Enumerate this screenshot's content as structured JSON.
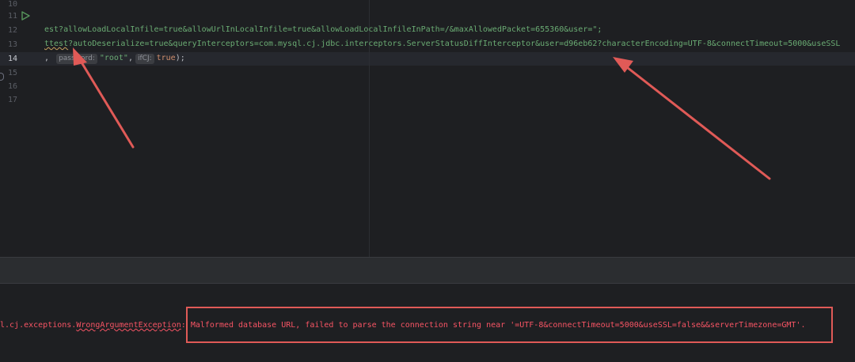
{
  "gutter": {
    "line_numbers": [
      "10",
      "11",
      "12",
      "13",
      "14",
      "15",
      "16",
      "17"
    ],
    "current_line": "14"
  },
  "code": {
    "line12": "est?allowLoadLocalInfile=true&allowUrlInLocalInfile=true&allowLoadLocalInfileInPath=/&maxAllowedPacket=655360&user=\";",
    "line13_prefix": "ttest",
    "line13_rest": "?autoDeserialize=true&queryInterceptors=com.mysql.cj.jdbc.interceptors.ServerStatusDiffInterceptor&user=d96eb62?characterEncoding=UTF-8&connectTimeout=5000&useSSL",
    "line14_lead": ",",
    "line14_hint_password": "password:",
    "line14_password_value": "\"root\"",
    "line14_comma": ",",
    "line14_hint_ifcj": "ifCJ:",
    "line14_true": "true",
    "line14_end": ");"
  },
  "console": {
    "exception_prefix": "l.cj.exceptions.",
    "exception_class": "WrongArgumentException",
    "message": ": Malformed database URL, failed to parse the connection string near '=UTF-8&connectTimeout=5000&useSSL=false&&serverTimezone=GMT'."
  },
  "colors": {
    "background": "#1e1f22",
    "string": "#6aab73",
    "error": "#f75464",
    "annotation": "#e05a57"
  },
  "icons": {
    "run": "run-play-icon",
    "fold": "fold-marker-icon"
  }
}
